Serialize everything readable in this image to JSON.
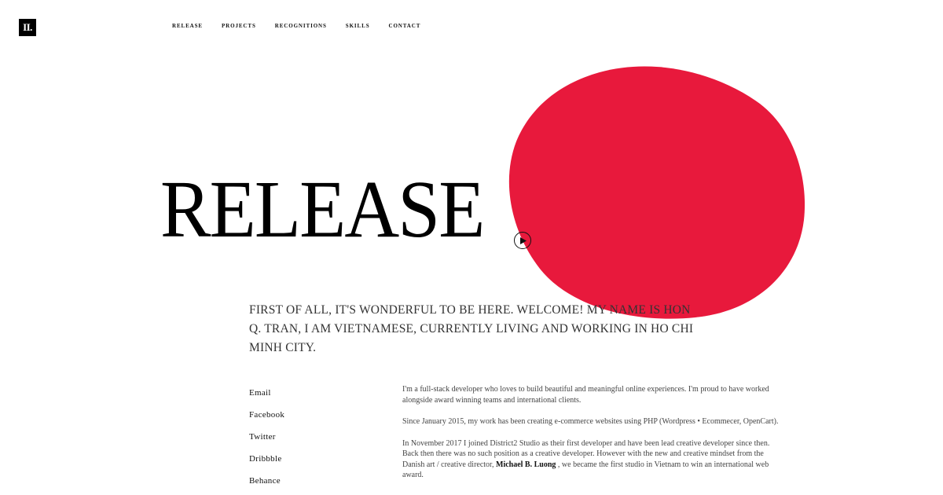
{
  "logo": {
    "text": "II."
  },
  "nav": {
    "items": [
      "RELEASE",
      "PROJECTS",
      "RECOGNITIONS",
      "SKILLS",
      "CONTACT"
    ]
  },
  "hero": {
    "title": "RELEASE",
    "accent_color": "#e8193c",
    "play_icon": "play-icon"
  },
  "intro": {
    "text": "FIRST OF ALL, IT'S WONDERFUL TO BE HERE. WELCOME! MY NAME IS HON Q. TRAN, I AM VIETNAMESE, CURRENTLY LIVING AND WORKING IN HO CHI MINH CITY."
  },
  "social": {
    "links": [
      "Email",
      "Facebook",
      "Twitter",
      "Dribbble",
      "Behance"
    ]
  },
  "bio": {
    "p1": "I'm a full-stack developer who loves to build beautiful and meaningful online experiences. I'm proud to have worked alongside award winning teams and international clients.",
    "p2": "Since January 2015, my work has been creating e-commerce websites using PHP (Wordpress • Ecommecer, OpenCart).",
    "p3_before": "In November 2017 I joined District2 Studio as their first developer and have been lead creative developer since then. Back then there was no such position as a creative developer. However with the new and creative mindset from the Danish art / creative director, ",
    "p3_name": "Michael B. Luong",
    "p3_after": " , we became the first studio in Vietnam to win an international web award."
  }
}
